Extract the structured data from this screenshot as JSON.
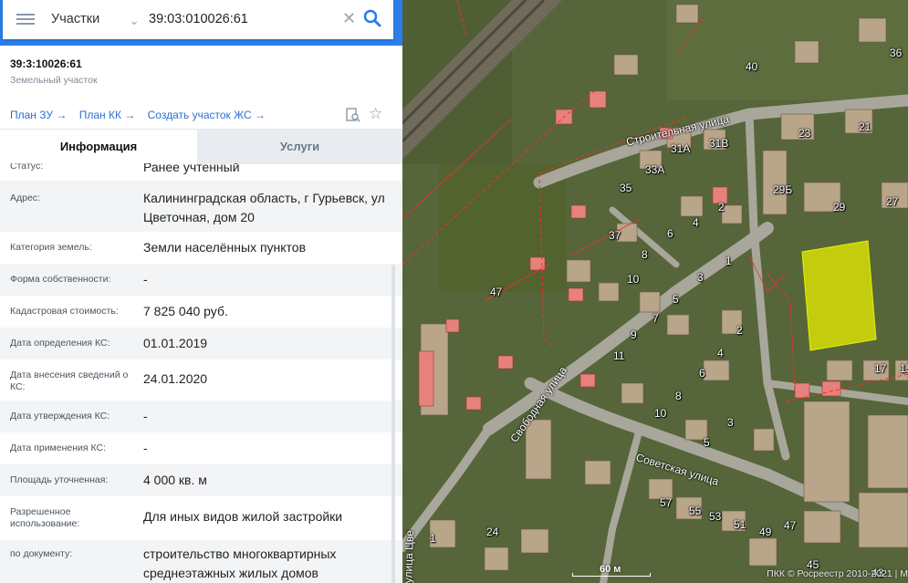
{
  "search": {
    "layer": "Участки",
    "query": "39:03:010026:61"
  },
  "object": {
    "cadastral_number": "39:3:10026:61",
    "type": "Земельный участок"
  },
  "links": {
    "plan_zu": "План ЗУ",
    "plan_kk": "План КК",
    "create_plot": "Создать участок ЖС"
  },
  "tabs": {
    "info": "Информация",
    "services": "Услуги"
  },
  "fields": [
    {
      "label": "Статус:",
      "value": "Ранее учтенный"
    },
    {
      "label": "Адрес:",
      "value": "Калининградская область, г Гурьевск, ул Цветочная, дом 20"
    },
    {
      "label": "Категория земель:",
      "value": "Земли населённых пунктов"
    },
    {
      "label": "Форма собственности:",
      "value": "-"
    },
    {
      "label": "Кадастровая стоимость:",
      "value": "7 825 040 руб."
    },
    {
      "label": "Дата определения КС:",
      "value": "01.01.2019"
    },
    {
      "label": "Дата внесения сведений о КС:",
      "value": "24.01.2020"
    },
    {
      "label": "Дата утверждения КС:",
      "value": "-"
    },
    {
      "label": "Дата применения КС:",
      "value": "-"
    },
    {
      "label": "Площадь уточненная:",
      "value": "4 000 кв. м"
    },
    {
      "label": "Разрешенное использование:",
      "value": "Для иных видов жилой застройки"
    },
    {
      "label": "по документу:",
      "value": "строительство многоквартирных среднеэтажных жилых домов"
    }
  ],
  "map": {
    "streets": {
      "stroitelnaya": "Строительная улица",
      "svobodnaya": "Свободная улица",
      "sovetskaya": "Советская улица",
      "tsvetochnaya": "улица Цве"
    },
    "house_numbers": [
      "40",
      "36",
      "23",
      "21",
      "31А",
      "31В",
      "33А",
      "35",
      "29Б",
      "29",
      "27",
      "2",
      "4",
      "6",
      "37",
      "8",
      "1",
      "3",
      "10",
      "5",
      "47",
      "7",
      "2",
      "9",
      "11",
      "4",
      "6",
      "8",
      "17",
      "15",
      "10",
      "3",
      "5",
      "57",
      "55",
      "53",
      "51",
      "49",
      "47",
      "24",
      "1",
      "45",
      "43"
    ],
    "scale": "60 м",
    "copyright": "ПКК © Росреестр 2010-2021 | М"
  },
  "colors": {
    "accent": "#2b7de9",
    "selected_plot": "#e8f000",
    "plot_lines": "#ff2a2a"
  }
}
